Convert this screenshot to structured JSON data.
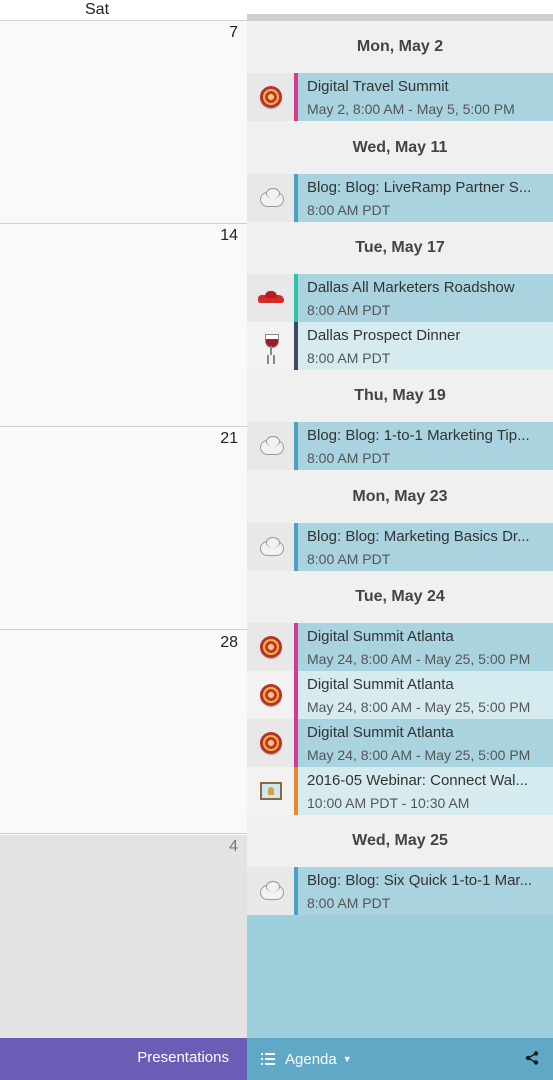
{
  "calendar": {
    "day_header": "Sat",
    "weeks": [
      {
        "number": "7"
      },
      {
        "number": "14"
      },
      {
        "number": "21"
      },
      {
        "number": "28"
      },
      {
        "number": "4"
      }
    ]
  },
  "agenda": {
    "days": [
      {
        "label": "Mon, May 2"
      },
      {
        "label": "Wed, May 11"
      },
      {
        "label": "Tue, May 17"
      },
      {
        "label": "Thu, May 19"
      },
      {
        "label": "Mon, May 23"
      },
      {
        "label": "Tue, May 24"
      },
      {
        "label": "Wed, May 25"
      }
    ],
    "events": [
      {
        "title": "Digital Travel Summit",
        "time": "May 2, 8:00 AM - May 5, 5:00 PM",
        "icon": "target-icon",
        "color": "#d63a8f"
      },
      {
        "title": "Blog: Blog: LiveRamp Partner S...",
        "time": "8:00 AM PDT",
        "icon": "cloud-icon",
        "color": "#4aa3c4"
      },
      {
        "title": "Dallas All Marketers Roadshow",
        "time": "8:00 AM PDT",
        "icon": "car-icon",
        "color": "#2ec4a8"
      },
      {
        "title": "Dallas Prospect Dinner",
        "time": "8:00 AM PDT",
        "icon": "wine-icon",
        "color": "#3e4a63"
      },
      {
        "title": "Blog: Blog: 1-to-1 Marketing Tip...",
        "time": "8:00 AM PDT",
        "icon": "cloud-icon",
        "color": "#4aa3c4"
      },
      {
        "title": "Blog: Blog: Marketing Basics Dr...",
        "time": "8:00 AM PDT",
        "icon": "cloud-icon",
        "color": "#4aa3c4"
      },
      {
        "title": "Digital Summit Atlanta",
        "time": "May 24, 8:00 AM - May 25, 5:00 PM",
        "icon": "target-icon",
        "color": "#d63a8f"
      },
      {
        "title": "Digital Summit Atlanta",
        "time": "May 24, 8:00 AM - May 25, 5:00 PM",
        "icon": "target-icon",
        "color": "#d63a8f"
      },
      {
        "title": "Digital Summit Atlanta",
        "time": "May 24, 8:00 AM - May 25, 5:00 PM",
        "icon": "target-icon",
        "color": "#d63a8f"
      },
      {
        "title": "2016-05 Webinar: Connect Wal...",
        "time": "10:00 AM PDT - 10:30 AM",
        "icon": "presentation-icon",
        "color": "#e8862e"
      },
      {
        "title": "Blog: Blog: Six Quick 1-to-1 Mar...",
        "time": "8:00 AM PDT",
        "icon": "cloud-icon",
        "color": "#4aa3c4"
      }
    ]
  },
  "toolbar": {
    "presentations_label": "Presentations",
    "view_label": "Agenda"
  }
}
